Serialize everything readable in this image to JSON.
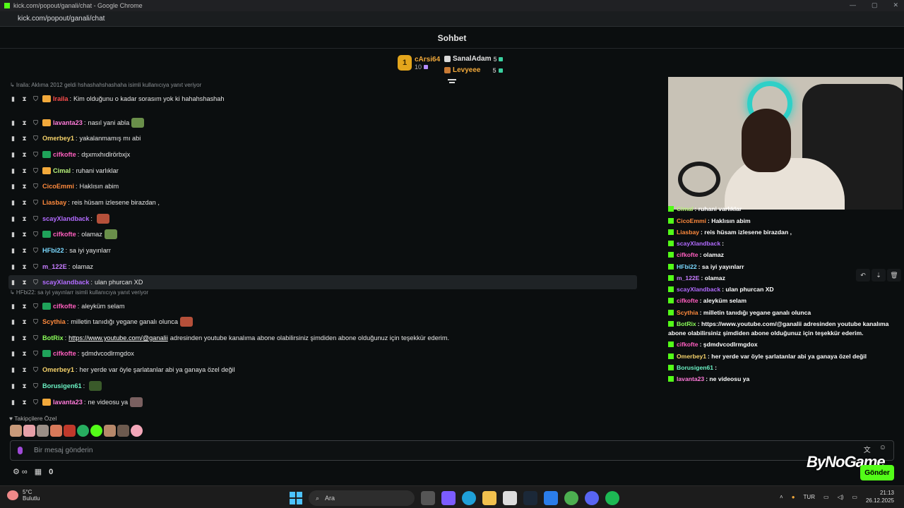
{
  "window": {
    "title": "kick.com/popout/ganali/chat - Google Chrome",
    "url": "kick.com/popout/ganali/chat"
  },
  "chat": {
    "title": "Sohbet",
    "leaderboard": {
      "first": {
        "rank": "1",
        "name": "cArsi64",
        "count": "10"
      },
      "second": {
        "name": "SanalAdam",
        "count": "5"
      },
      "third": {
        "name": "Levyeee",
        "count": "5"
      }
    },
    "replies": [
      {
        "text": "↳ Iraila: Aklıma 2012 geldi hshashahshashaha isimli kullanıcıya yanıt veriyor"
      },
      {
        "text": "↳ HFbi22: sa iyi yayınlarr isimli kullanıcıya yanıt veriyor"
      }
    ],
    "messages": [
      {
        "user": "Iraila",
        "color": "#ff4d4d",
        "text": "Kim olduğunu o kadar sorasım yok ki hahahshashah"
      },
      {
        "user": "lavanta23",
        "color": "#ff7ad9",
        "text": "nasıl yani abla"
      },
      {
        "user": "Omerbey1",
        "color": "#f6d36b",
        "text": "yakalanmamış mı abi"
      },
      {
        "user": "cifkofte",
        "color": "#ff5fbf",
        "text": "dşxmxhıdlrörbxjx"
      },
      {
        "user": "Cimal",
        "color": "#b8f27a",
        "text": "ruhani varlıklar"
      },
      {
        "user": "CicoEmmi",
        "color": "#ff8a3d",
        "text": "Haklısın abim"
      },
      {
        "user": "Liasbay",
        "color": "#ff8a3d",
        "text": "reis hüsam izlesene birazdan ,"
      },
      {
        "user": "scayXlandback",
        "color": "#b26bff",
        "text": ""
      },
      {
        "user": "cifkofte",
        "color": "#ff5fbf",
        "text": "olamaz"
      },
      {
        "user": "HFbi22",
        "color": "#7ad9ff",
        "text": "sa iyi yayınlarr"
      },
      {
        "user": "m_122E",
        "color": "#c77dff",
        "text": "olamaz"
      },
      {
        "user": "scayXlandback",
        "color": "#b26bff",
        "text": "ulan phurcan XD"
      },
      {
        "user": "cifkofte",
        "color": "#ff5fbf",
        "text": "aleyküm selam"
      },
      {
        "user": "Scythia",
        "color": "#ff8a3d",
        "text": "milletin tanıdığı yegane ganalı olunca"
      },
      {
        "user": "BotRix",
        "color": "#8cff5a",
        "text_before": "",
        "link": "https://www.youtube.com/@ganalii",
        "text_after": "adresinden youtube kanalıma abone olabilirsiniz şimdiden abone olduğunuz için teşekkür ederim."
      },
      {
        "user": "cifkofte",
        "color": "#ff5fbf",
        "text": "şdmdvcodlrmgdox"
      },
      {
        "user": "Omerbey1",
        "color": "#f6d36b",
        "text": "her yerde var öyle şarlatanlar abi ya ganaya özel değil"
      },
      {
        "user": "Borusigen61",
        "color": "#6bf2c4",
        "text": ""
      },
      {
        "user": "lavanta23",
        "color": "#ff7ad9",
        "text": "ne videosu ya"
      }
    ],
    "followers_label": "Takipçilere Özel",
    "input_placeholder": "Bir mesaj gönderin",
    "viewer_count": "0",
    "send_label": "Gönder"
  },
  "overlay": {
    "lines": [
      {
        "user": "Cimal",
        "color": "#b8f27a",
        "text": ": ruhani varlıklar"
      },
      {
        "user": "CicoEmmi",
        "color": "#ff8a3d",
        "text": ": Haklısın abim"
      },
      {
        "user": "Liasbay",
        "color": "#ff8a3d",
        "text": ": reis hüsam izlesene birazdan ,"
      },
      {
        "user": "scayXlandback",
        "color": "#b26bff",
        "text": ":"
      },
      {
        "user": "cifkofte",
        "color": "#ff5fbf",
        "text": ": olamaz"
      },
      {
        "user": "HFbi22",
        "color": "#7ad9ff",
        "text": ": sa iyi yayınlarr"
      },
      {
        "user": "m_122E",
        "color": "#c77dff",
        "text": ": olamaz"
      },
      {
        "user": "scayXlandback",
        "color": "#b26bff",
        "text": ": ulan phurcan XD"
      },
      {
        "user": "cifkofte",
        "color": "#ff5fbf",
        "text": ": aleyküm selam"
      },
      {
        "user": "Scythia",
        "color": "#ff8a3d",
        "text": ": milletin tanıdığı yegane ganalı olunca"
      },
      {
        "user": "BotRix",
        "color": "#8cff5a",
        "text": ": https://www.youtube.com/@ganalii adresinden youtube kanalıma abone olabilirsiniz şimdiden abone olduğunuz için teşekkür ederim."
      },
      {
        "user": "cifkofte",
        "color": "#ff5fbf",
        "text": ": şdmdvcodlrmgdox"
      },
      {
        "user": "Omerbey1",
        "color": "#f6d36b",
        "text": ": her yerde var öyle şarlatanlar abi ya ganaya özel değil"
      },
      {
        "user": "Borusigen61",
        "color": "#6bf2c4",
        "text": ":"
      },
      {
        "user": "lavanta23",
        "color": "#ff7ad9",
        "text": ": ne videosu ya"
      }
    ],
    "watermark": "ByNoGame"
  },
  "taskbar": {
    "weather_temp": "5°C",
    "weather_desc": "Bulutlu",
    "search_placeholder": "Ara",
    "lang": "TUR",
    "time": "21:13",
    "date": "26.12.2025"
  },
  "colors": {
    "accent": "#53fc18",
    "background": "#0b0e0f"
  }
}
